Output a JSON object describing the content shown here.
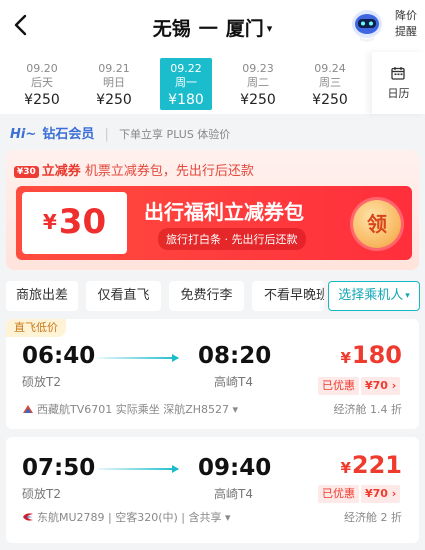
{
  "header": {
    "origin": "无锡",
    "arrow": "一",
    "destination": "厦门",
    "caret": "▾",
    "price_alert_line1": "降价",
    "price_alert_line2": "提醒"
  },
  "dates": [
    {
      "date": "09.20",
      "day": "后天",
      "price": "¥250",
      "active": false
    },
    {
      "date": "09.21",
      "day": "明日",
      "price": "¥250",
      "active": false
    },
    {
      "date": "09.22",
      "day": "周一",
      "price": "¥180",
      "active": true
    },
    {
      "date": "09.23",
      "day": "周二",
      "price": "¥250",
      "active": false
    },
    {
      "date": "09.24",
      "day": "周三",
      "price": "¥250",
      "active": false
    }
  ],
  "calendar_label": "日历",
  "member": {
    "hi": "Hi~",
    "level": "钻石会员",
    "sep": "|",
    "desc": "下单立享 PLUS 体验价"
  },
  "promo": {
    "badge": "¥30",
    "title": "立减券",
    "desc": "机票立减券包，先出行后还款",
    "coupon_yen": "¥",
    "coupon_amount": "30",
    "coupon_title": "出行福利立减券包",
    "coupon_sub": "旅行打白条 · 先出行后还款",
    "claim": "领"
  },
  "filters": [
    {
      "label": "商旅出差"
    },
    {
      "label": "仅看直飞"
    },
    {
      "label": "免费行李"
    },
    {
      "label": "不看早晚班"
    },
    {
      "label": "选择乘机人",
      "caret": "▾"
    }
  ],
  "flights": [
    {
      "tag": "直飞低价",
      "dep_time": "06:40",
      "dep_airport": "硕放T2",
      "arr_time": "08:20",
      "arr_airport": "高崎T4",
      "price_yen": "¥",
      "price": "180",
      "discount_label": "已优惠",
      "discount_amount": "¥70 ›",
      "airline": "西藏航TV6701 实际乘坐 深航ZH8527 ▾",
      "cabin": "经济舱 1.4 折"
    },
    {
      "tag": "",
      "dep_time": "07:50",
      "dep_airport": "硕放T2",
      "arr_time": "09:40",
      "arr_airport": "高崎T4",
      "price_yen": "¥",
      "price": "221",
      "discount_label": "已优惠",
      "discount_amount": "¥70 ›",
      "airline": "东航MU2789 | 空客320(中) | 含共享 ▾",
      "cabin": "经济舱 2 折"
    }
  ],
  "colors": {
    "accent": "#1bbccc",
    "price": "#ef3b2e",
    "member": "#3b6fd6"
  }
}
